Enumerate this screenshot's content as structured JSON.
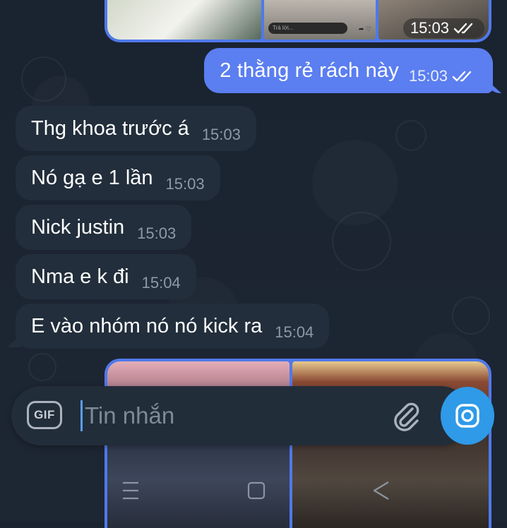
{
  "album_top": {
    "time": "15:03",
    "preview_input": "Trả lời...",
    "status_icon": "double-check-icon"
  },
  "messages": [
    {
      "direction": "out",
      "text": "2 thằng rẻ rách này",
      "time": "15:03",
      "status_icon": "double-check-icon"
    },
    {
      "direction": "in",
      "text": "Thg khoa trước á",
      "time": "15:03"
    },
    {
      "direction": "in",
      "text": "Nó gạ e 1 lần",
      "time": "15:03"
    },
    {
      "direction": "in",
      "text": "Nick justin",
      "time": "15:03"
    },
    {
      "direction": "in",
      "text": "Nma e k đi",
      "time": "15:04"
    },
    {
      "direction": "in",
      "text": "E vào nhóm nó nó kick ra",
      "time": "15:04"
    }
  ],
  "composer": {
    "gif_label": "GIF",
    "placeholder": "Tin nhắn",
    "value": ""
  },
  "nav": {
    "menu_icon": "menu-icon",
    "home_icon": "home-square-icon",
    "back_icon": "back-triangle-icon"
  },
  "colors": {
    "background": "#1b2430",
    "outgoing_bubble": "#5b7ef0",
    "incoming_bubble": "#222e3b",
    "accent": "#2f9ae8"
  }
}
